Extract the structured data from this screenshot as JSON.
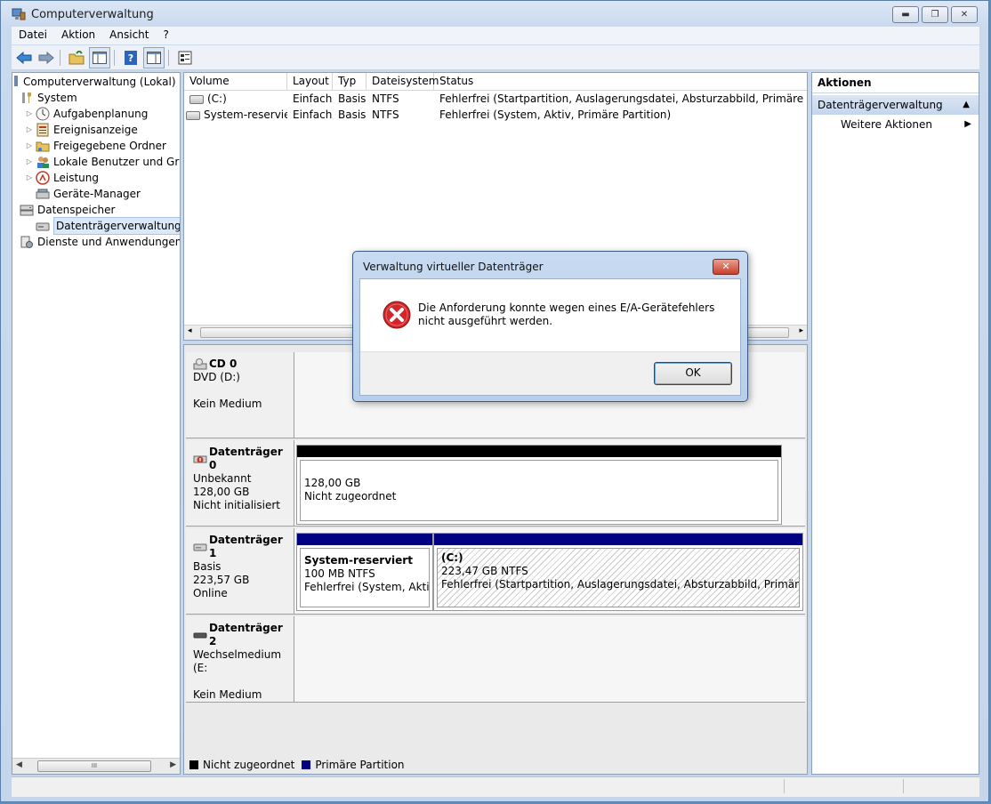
{
  "window": {
    "title": "Computerverwaltung"
  },
  "menu": [
    "Datei",
    "Aktion",
    "Ansicht",
    "?"
  ],
  "tree": {
    "root": "Computerverwaltung (Lokal)",
    "system": "System",
    "aufgabenplanung": "Aufgabenplanung",
    "ereignisanzeige": "Ereignisanzeige",
    "freigegebene": "Freigegebene Ordner",
    "lokale": "Lokale Benutzer und Grupp",
    "leistung": "Leistung",
    "geraete": "Geräte-Manager",
    "datenspeicher": "Datenspeicher",
    "datentraeger": "Datenträgerverwaltung",
    "dienste": "Dienste und Anwendungen",
    "scroll_thumb": "III"
  },
  "volumes": {
    "headers": [
      "Volume",
      "Layout",
      "Typ",
      "Dateisystem",
      "Status"
    ],
    "rows": [
      [
        "(C:)",
        "Einfach",
        "Basis",
        "NTFS",
        "Fehlerfrei (Startpartition, Auslagerungsdatei, Absturzabbild, Primäre Partition)"
      ],
      [
        "System-reserviert",
        "Einfach",
        "Basis",
        "NTFS",
        "Fehlerfrei (System, Aktiv, Primäre Partition)"
      ]
    ]
  },
  "disks": {
    "cd0": {
      "name": "CD 0",
      "line1": "DVD (D:)",
      "line3": "Kein Medium"
    },
    "disk0": {
      "name": "Datenträger 0",
      "line1": "Unbekannt",
      "line2": "128,00 GB",
      "line3": "Nicht initialisiert",
      "part_size": "128,00 GB",
      "part_status": "Nicht zugeordnet"
    },
    "disk1": {
      "name": "Datenträger 1",
      "line1": "Basis",
      "line2": "223,57 GB",
      "line3": "Online",
      "p1_name": "System-reserviert",
      "p1_size": "100 MB NTFS",
      "p1_status": "Fehlerfrei (System, Aktiv, P",
      "p2_name": "(C:)",
      "p2_size": "223,47 GB NTFS",
      "p2_status": "Fehlerfrei (Startpartition, Auslagerungsdatei, Absturzabbild, Primäre Partition)"
    },
    "disk2": {
      "name": "Datenträger 2",
      "line1": "Wechselmedium (E:",
      "line3": "Kein Medium"
    }
  },
  "legend": {
    "unallocated": "Nicht zugeordnet",
    "primary": "Primäre Partition"
  },
  "actions": {
    "header": "Aktionen",
    "selected": "Datenträgerverwaltung",
    "more": "Weitere Aktionen"
  },
  "dialog": {
    "title": "Verwaltung virtueller Datenträger",
    "message": "Die Anforderung konnte wegen eines E/A-Gerätefehlers nicht ausgeführt werden.",
    "ok": "OK"
  },
  "colors": {
    "unallocated": "#000000",
    "primary": "#000080"
  }
}
